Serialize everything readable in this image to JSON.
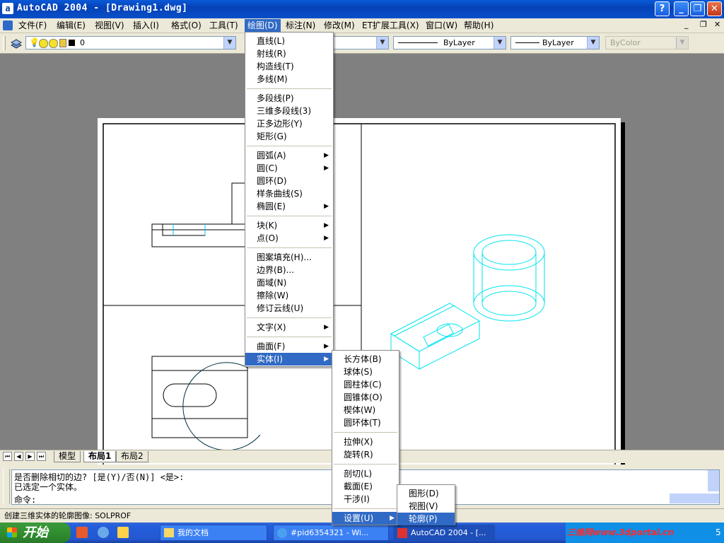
{
  "window": {
    "title": "AutoCAD 2004 - [Drawing1.dwg]",
    "app_icon_glyph": "a",
    "buttons": {
      "help": "?",
      "minimize": "_",
      "restore": "❐",
      "close": "✕"
    }
  },
  "menubar": {
    "items": [
      "文件(F)",
      "编辑(E)",
      "视图(V)",
      "插入(I)",
      "格式(O)",
      "工具(T)",
      "绘图(D)",
      "标注(N)",
      "修改(M)",
      "ET扩展工具(X)",
      "窗口(W)",
      "帮助(H)"
    ],
    "active": "绘图(D)",
    "mdi_buttons": [
      "_",
      "❐",
      "✕"
    ]
  },
  "toolbar": {
    "layer_value": "0",
    "linetype": "ByLayer",
    "lineweight": "ByLayer",
    "plotstyle": "ByColor"
  },
  "draw_menu": {
    "groups": [
      [
        {
          "label": "直线(L)"
        },
        {
          "label": "射线(R)"
        },
        {
          "label": "构造线(T)"
        },
        {
          "label": "多线(M)"
        }
      ],
      [
        {
          "label": "多段线(P)"
        },
        {
          "label": "三维多段线(3)"
        },
        {
          "label": "正多边形(Y)"
        },
        {
          "label": "矩形(G)"
        }
      ],
      [
        {
          "label": "圆弧(A)",
          "sub": true
        },
        {
          "label": "圆(C)",
          "sub": true
        },
        {
          "label": "圆环(D)"
        },
        {
          "label": "样条曲线(S)"
        },
        {
          "label": "椭圆(E)",
          "sub": true
        }
      ],
      [
        {
          "label": "块(K)",
          "sub": true
        },
        {
          "label": "点(O)",
          "sub": true
        }
      ],
      [
        {
          "label": "图案填充(H)..."
        },
        {
          "label": "边界(B)..."
        },
        {
          "label": "面域(N)"
        },
        {
          "label": "擦除(W)"
        },
        {
          "label": "修订云线(U)"
        }
      ],
      [
        {
          "label": "文字(X)",
          "sub": true
        }
      ],
      [
        {
          "label": "曲面(F)",
          "sub": true
        },
        {
          "label": "实体(I)",
          "sub": true,
          "highlight": true
        }
      ]
    ]
  },
  "solids_menu": {
    "groups": [
      [
        {
          "label": "长方体(B)"
        },
        {
          "label": "球体(S)"
        },
        {
          "label": "圆柱体(C)"
        },
        {
          "label": "圆锥体(O)"
        },
        {
          "label": "楔体(W)"
        },
        {
          "label": "圆环体(T)"
        }
      ],
      [
        {
          "label": "拉伸(X)"
        },
        {
          "label": "旋转(R)"
        }
      ],
      [
        {
          "label": "剖切(L)"
        },
        {
          "label": "截面(E)"
        },
        {
          "label": "干涉(I)"
        }
      ],
      [
        {
          "label": "设置(U)",
          "sub": true,
          "highlight": true
        }
      ]
    ]
  },
  "setup_menu": {
    "items": [
      {
        "label": "图形(D)"
      },
      {
        "label": "视图(V)"
      },
      {
        "label": "轮廓(P)",
        "highlight": true
      }
    ]
  },
  "layout_tabs": {
    "items": [
      "模型",
      "布局1",
      "布局2"
    ],
    "active": "布局1"
  },
  "command": {
    "lines": [
      "是否删除相切的边? [是(Y)/否(N)] <是>:",
      "已选定一个实体。"
    ],
    "prompt": "命令:"
  },
  "statusbar": {
    "text": "创建三维实体的轮廓图像:   SOLPROF"
  },
  "taskbar": {
    "start": "开始",
    "items": [
      {
        "label": "我的文档"
      },
      {
        "label": "#pid6354321 - Wi..."
      },
      {
        "label": "AutoCAD 2004 - [..."
      }
    ],
    "tray_text": "三维网www.3dportal.cn",
    "clock": "5"
  },
  "colors": {
    "menu_highlight": "#316ac5",
    "model_cyan": "#00e5ee",
    "title_blue": "#0a4fc8"
  }
}
